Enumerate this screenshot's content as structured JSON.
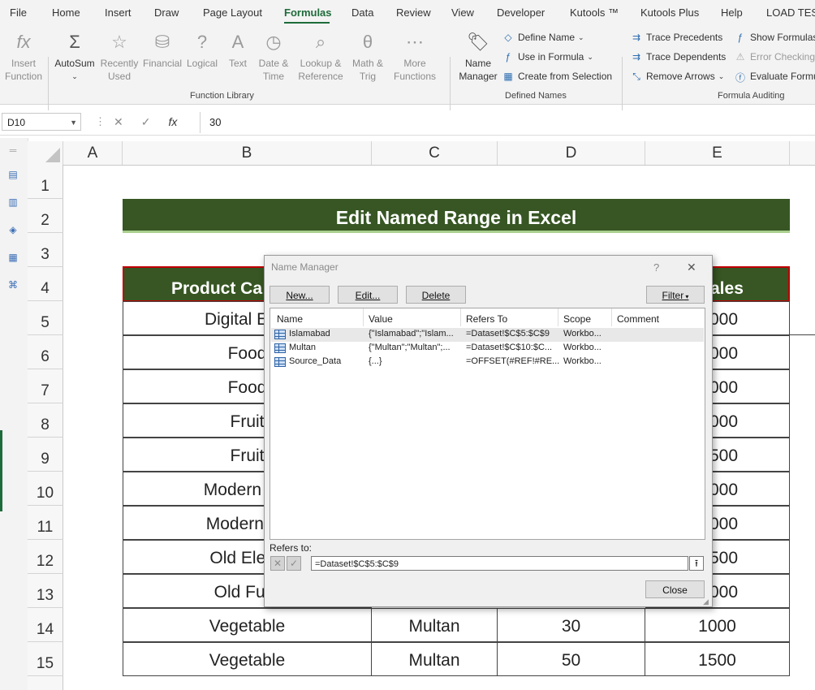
{
  "tabs": [
    "File",
    "Home",
    "Insert",
    "Draw",
    "Page Layout",
    "Formulas",
    "Data",
    "Review",
    "View",
    "Developer",
    "Kutools ™",
    "Kutools Plus",
    "Help",
    "LOAD TEST"
  ],
  "active_tab": "Formulas",
  "ribbon": {
    "function_library": {
      "insert_function": [
        "Insert",
        "Function"
      ],
      "autosum": "AutoSum",
      "recently_used": [
        "Recently",
        "Used"
      ],
      "financial": "Financial",
      "logical": "Logical",
      "text": "Text",
      "date_time": [
        "Date &",
        "Time"
      ],
      "lookup": [
        "Lookup &",
        "Reference"
      ],
      "math": [
        "Math &",
        "Trig"
      ],
      "more": [
        "More",
        "Functions"
      ],
      "label": "Function Library"
    },
    "defined_names": {
      "name_manager": [
        "Name",
        "Manager"
      ],
      "define_name": "Define Name",
      "use_in_formula": "Use in Formula",
      "create_from_selection": "Create from Selection",
      "label": "Defined Names"
    },
    "formula_auditing": {
      "trace_precedents": "Trace Precedents",
      "trace_dependents": "Trace Dependents",
      "remove_arrows": "Remove Arrows",
      "show_formulas": "Show Formulas",
      "error_checking": "Error Checking",
      "evaluate_formula": "Evaluate Formu",
      "label": "Formula Auditing"
    }
  },
  "formula_bar": {
    "name_box": "D10",
    "fx": "fx",
    "value": "30"
  },
  "columns": [
    "A",
    "B",
    "C",
    "D",
    "E"
  ],
  "rows": [
    "1",
    "2",
    "3",
    "4",
    "5",
    "6",
    "7",
    "8",
    "9",
    "10",
    "11",
    "12",
    "13",
    "14",
    "15"
  ],
  "sheet": {
    "title": "Edit Named Range in Excel",
    "header_left": "Product Ca",
    "header_right": "ales",
    "col_b": [
      "Digital Elec",
      "Food",
      "Food",
      "Fruit",
      "Fruit",
      "Modern Ele",
      "Modern Fu",
      "Old Electr",
      "Old Furn",
      "Vegetable",
      "Vegetable"
    ],
    "col_e_visible": [
      "000",
      "000",
      "000",
      "000",
      "500",
      "000",
      "000",
      "500",
      "000"
    ],
    "row14": [
      "Vegetable",
      "Multan",
      "30",
      "1000"
    ],
    "row15": [
      "Vegetable",
      "Multan",
      "50",
      "1500"
    ]
  },
  "dialog": {
    "title": "Name Manager",
    "help": "?",
    "close_x": "✕",
    "buttons": {
      "new": "New...",
      "edit": "Edit...",
      "delete": "Delete",
      "filter": "Filter"
    },
    "list_headers": [
      "Name",
      "Value",
      "Refers To",
      "Scope",
      "Comment"
    ],
    "names": [
      {
        "name": "Islamabad",
        "value": "{\"Islamabad\";\"Islam...",
        "refers_to": "=Dataset!$C$5:$C$9",
        "scope": "Workbo..."
      },
      {
        "name": "Multan",
        "value": "{\"Multan\";\"Multan\";...",
        "refers_to": "=Dataset!$C$10:$C...",
        "scope": "Workbo..."
      },
      {
        "name": "Source_Data",
        "value": "{...}",
        "refers_to": "=OFFSET(#REF!#RE...",
        "scope": "Workbo..."
      }
    ],
    "refers_to_label": "Refers to:",
    "refers_to_value": "=Dataset!$C$5:$C$9",
    "close_button": "Close"
  },
  "colors": {
    "accent": "#1e6b3a",
    "banner": "#375623",
    "banner_border": "#c00000"
  }
}
